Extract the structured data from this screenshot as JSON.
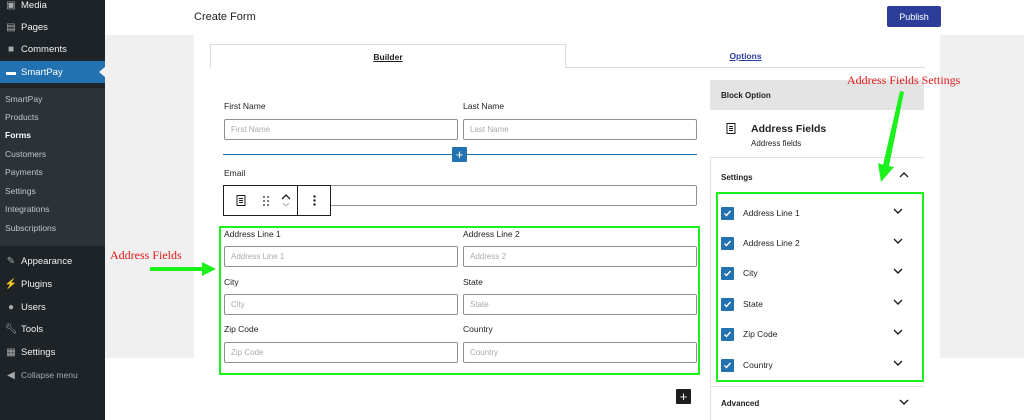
{
  "sidebar": {
    "items": [
      {
        "label": "Media",
        "icon": "media-icon"
      },
      {
        "label": "Pages",
        "icon": "pages-icon"
      },
      {
        "label": "Comments",
        "icon": "comments-icon"
      },
      {
        "label": "SmartPay",
        "icon": "smartpay-icon"
      }
    ],
    "submenu": [
      "SmartPay",
      "Products",
      "Forms",
      "Customers",
      "Payments",
      "Settings",
      "Integrations",
      "Subscriptions"
    ],
    "lower_items": [
      {
        "label": "Appearance",
        "icon": "appearance-icon"
      },
      {
        "label": "Plugins",
        "icon": "plugins-icon"
      },
      {
        "label": "Users",
        "icon": "users-icon"
      },
      {
        "label": "Tools",
        "icon": "tools-icon"
      },
      {
        "label": "Settings",
        "icon": "settings-icon"
      }
    ],
    "collapse_label": "Collapse menu"
  },
  "header": {
    "title": "Create Form",
    "publish_label": "Publish"
  },
  "tabs": {
    "builder": "Builder",
    "options": "Options"
  },
  "form": {
    "first_name": {
      "label": "First Name",
      "placeholder": "First Name"
    },
    "last_name": {
      "label": "Last Name",
      "placeholder": "Last Name"
    },
    "email": {
      "label": "Email"
    },
    "address1": {
      "label": "Address Line 1",
      "placeholder": "Address Line 1"
    },
    "address2": {
      "label": "Address Line 2",
      "placeholder": "Address 2"
    },
    "city": {
      "label": "City",
      "placeholder": "City"
    },
    "state": {
      "label": "State",
      "placeholder": "State"
    },
    "zip": {
      "label": "Zip Code",
      "placeholder": "Zip Code"
    },
    "country": {
      "label": "Country",
      "placeholder": "Country"
    }
  },
  "annotations": {
    "left": "Address Fields",
    "right": "Address Fields Settings"
  },
  "settings_panel": {
    "header": "Block Option",
    "block_title": "Address Fields",
    "block_subtitle": "Address fields",
    "settings_label": "Settings",
    "fields": [
      "Address Line 1",
      "Address Line 2",
      "City",
      "State",
      "Zip Code",
      "Country"
    ],
    "advanced_label": "Advanced"
  },
  "colors": {
    "accent": "#2271b1",
    "sidebar": "#1d2327",
    "highlight": "#1bf21b",
    "annotation": "#e01919",
    "publish": "#2d3e9a"
  }
}
